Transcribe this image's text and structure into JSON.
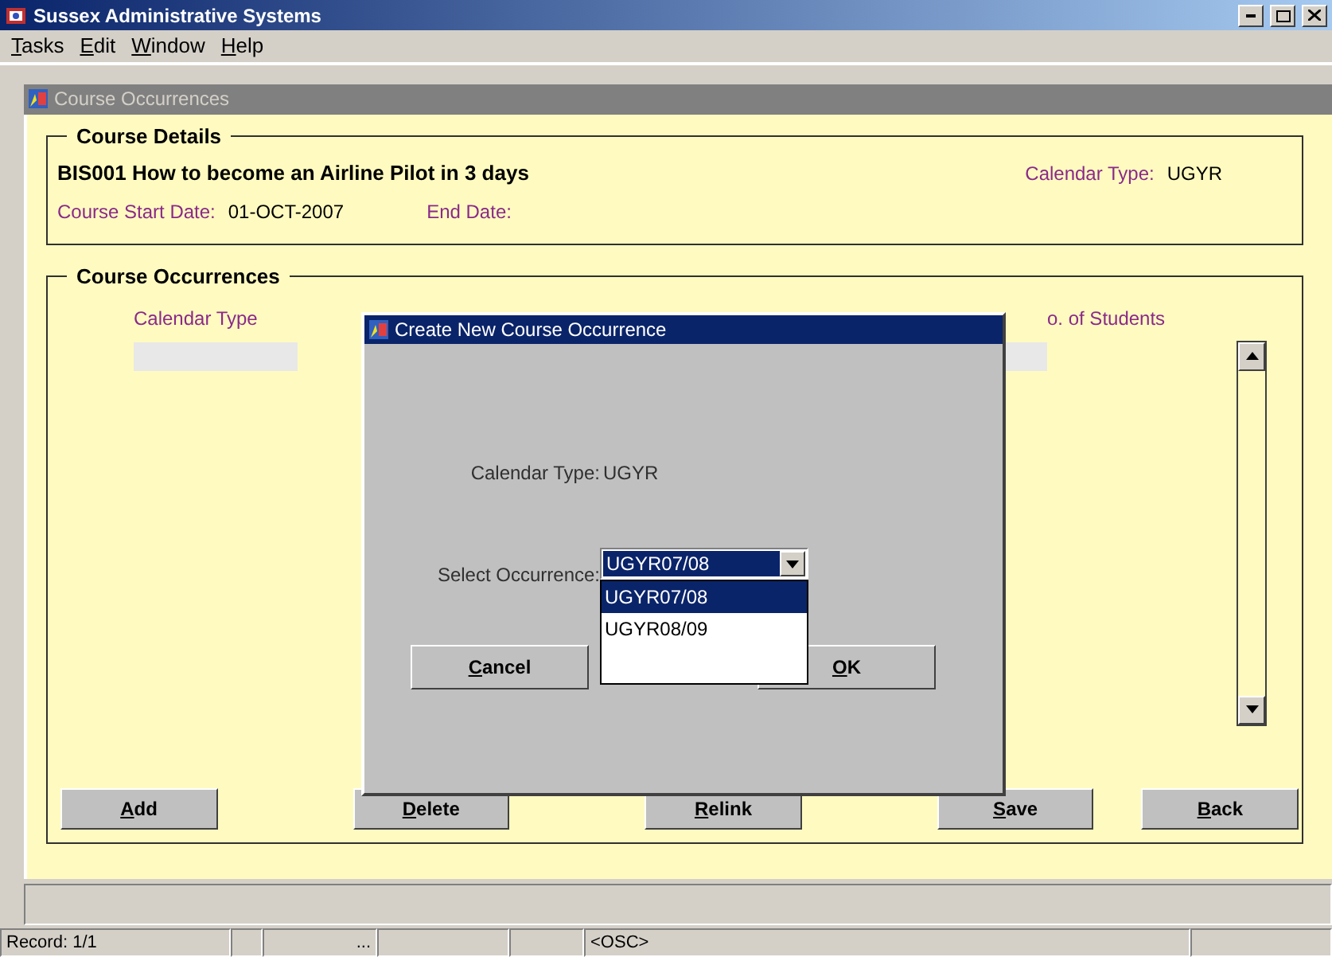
{
  "window": {
    "title": "Sussex Administrative Systems"
  },
  "menu": [
    "Tasks",
    "Edit",
    "Window",
    "Help"
  ],
  "form": {
    "title": "Course Occurrences"
  },
  "course_details": {
    "heading": "Course Details",
    "course": "BIS001 How to become an Airline Pilot in 3 days",
    "calendar_type_label": "Calendar Type:",
    "calendar_type": "UGYR",
    "start_date_label": "Course Start Date:",
    "start_date": "01-OCT-2007",
    "end_date_label": "End Date:"
  },
  "occurrences": {
    "heading": "Course Occurrences",
    "columns": [
      "Calendar Type",
      "o. of Students"
    ],
    "buttons": [
      "Add",
      "Delete",
      "Relink",
      "Save",
      "Back"
    ]
  },
  "dialog": {
    "title": "Create New Course Occurrence",
    "calendar_type_label": "Calendar Type:",
    "calendar_type": "UGYR",
    "select_label": "Select Occurrence:",
    "select_value": "UGYR07/08",
    "options": [
      {
        "label": "UGYR07/08",
        "selected": true
      },
      {
        "label": "UGYR08/09",
        "selected": false
      }
    ],
    "buttons": [
      "Cancel",
      "OK"
    ]
  },
  "status_bar": {
    "record": "Record: 1/1",
    "ellipsis": "...",
    "mode": "<OSC>"
  }
}
